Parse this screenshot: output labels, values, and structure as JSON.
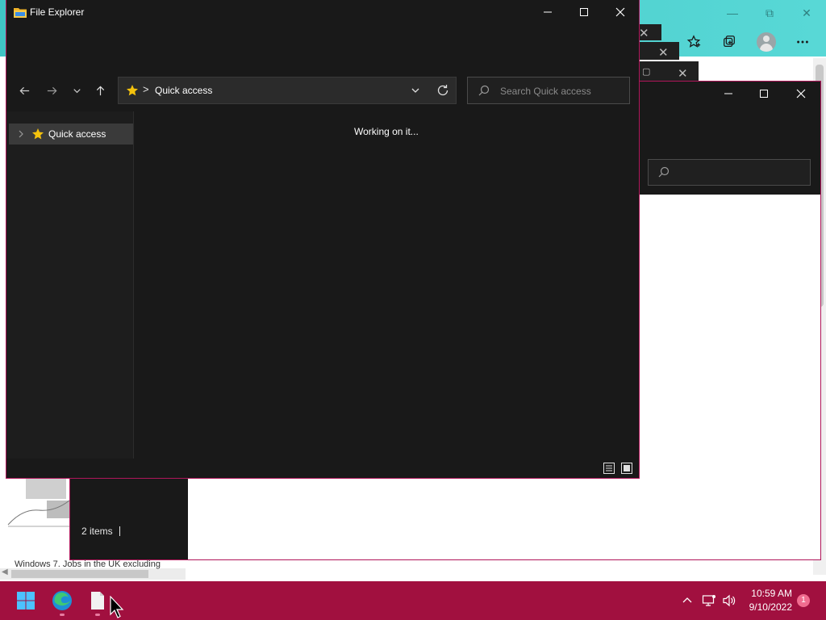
{
  "file_explorer": {
    "title": "File Explorer",
    "address": "Quick access",
    "address_separator": ">",
    "search_placeholder": "Search Quick access",
    "nav_item": "Quick access",
    "status_message": "Working on it..."
  },
  "background_explorer": {
    "status": "2 items"
  },
  "background_browser": {
    "page_text": "Windows 7. Jobs in the UK excluding"
  },
  "taskbar": {
    "time": "10:59 AM",
    "date": "9/10/2022",
    "notification_count": "1",
    "icons": [
      "windows-start-icon",
      "edge-icon",
      "file-icon"
    ]
  },
  "colors": {
    "taskbar": "#a1103f",
    "window_border": "#b0165a",
    "explorer_bg": "#191919",
    "accent_star": "#f4c20d",
    "edge_teal": "#40c4c4"
  }
}
